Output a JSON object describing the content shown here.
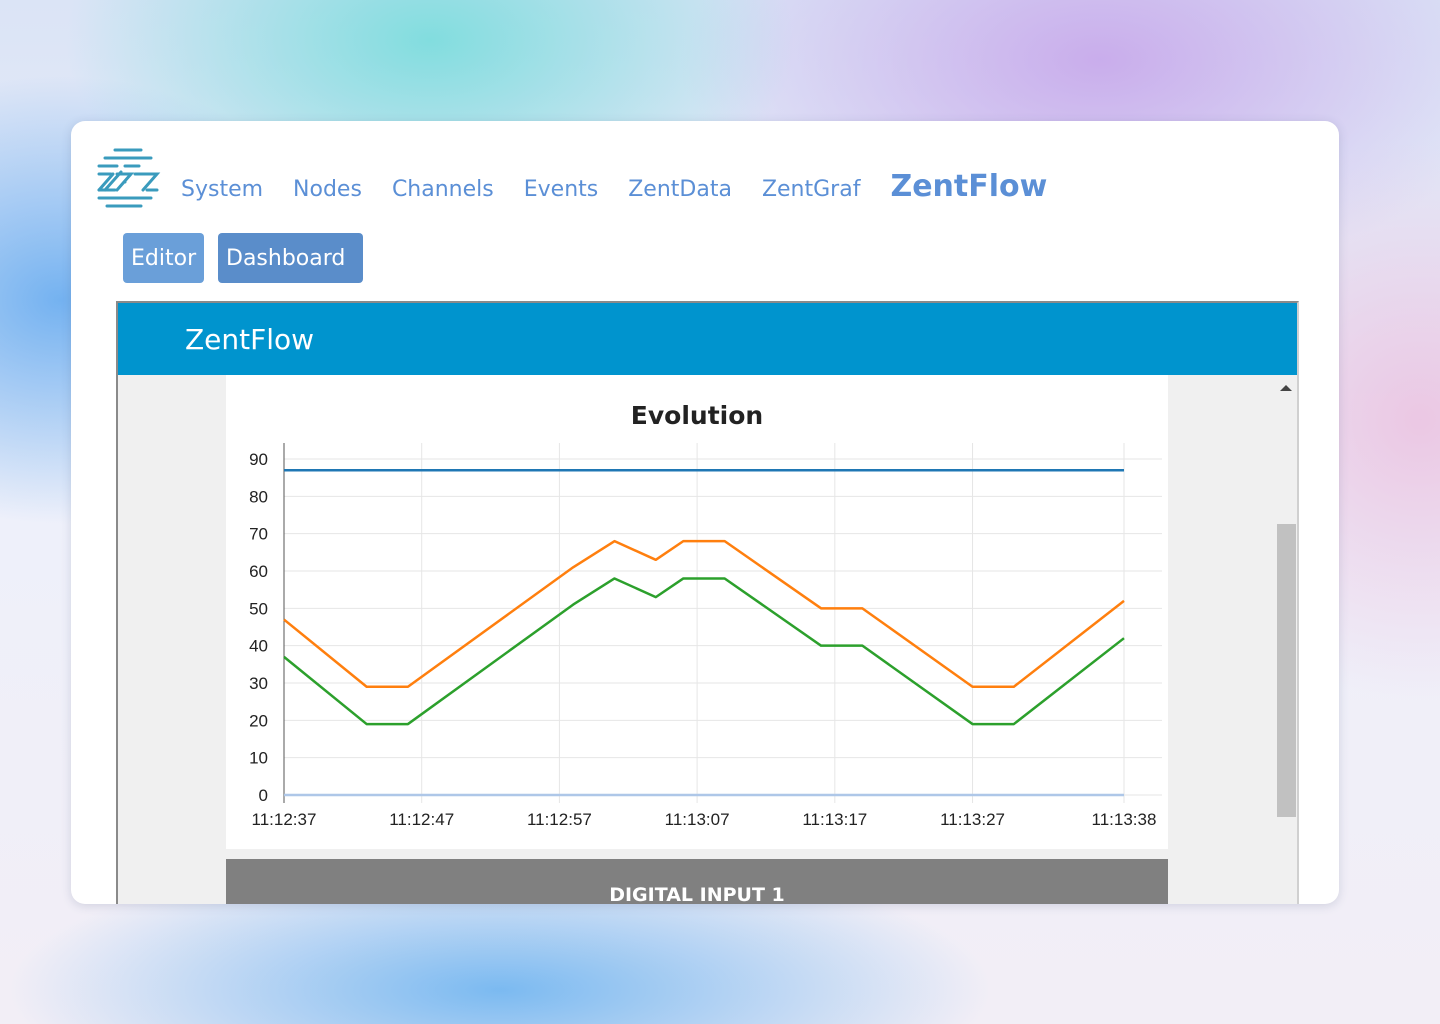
{
  "nav": {
    "items": [
      "System",
      "Nodes",
      "Channels",
      "Events",
      "ZentData",
      "ZentGraf"
    ],
    "active": "ZentFlow"
  },
  "subtabs": {
    "editor": "Editor",
    "dashboard": "Dashboard"
  },
  "dashboard": {
    "header_title": "ZentFlow",
    "next_section_label": "DIGITAL INPUT 1"
  },
  "colors": {
    "accent_nav": "#5b8fd6",
    "dashboard_header": "#0094ce",
    "series_blue": "#1f77b4",
    "series_orange": "#ff7f0e",
    "series_green": "#2ca02c",
    "series_lightblue": "#aec7e8"
  },
  "chart_data": {
    "type": "line",
    "title": "Evolution",
    "xlabel": "",
    "ylabel": "",
    "ylim": [
      0,
      90
    ],
    "yticks": [
      0,
      10,
      20,
      30,
      40,
      50,
      60,
      70,
      80,
      90
    ],
    "xlim_seconds_labels": [
      "11:12:37",
      "11:12:47",
      "11:12:57",
      "11:13:07",
      "11:13:17",
      "11:13:27",
      "11:13:38"
    ],
    "grid": true,
    "legend": "none",
    "series": [
      {
        "color": "#1f77b4",
        "x": [
          "11:12:37",
          "11:13:38"
        ],
        "y": [
          87,
          87
        ]
      },
      {
        "color": "#ff7f0e",
        "x": [
          "11:12:37",
          "11:12:43",
          "11:12:46",
          "11:12:58",
          "11:13:01",
          "11:13:04",
          "11:13:06",
          "11:13:09",
          "11:13:16",
          "11:13:19",
          "11:13:27",
          "11:13:30",
          "11:13:38"
        ],
        "y": [
          47,
          29,
          29,
          61,
          68,
          63,
          68,
          68,
          50,
          50,
          29,
          29,
          52
        ]
      },
      {
        "color": "#2ca02c",
        "x": [
          "11:12:37",
          "11:12:43",
          "11:12:46",
          "11:12:58",
          "11:13:01",
          "11:13:04",
          "11:13:06",
          "11:13:09",
          "11:13:16",
          "11:13:19",
          "11:13:27",
          "11:13:30",
          "11:13:38"
        ],
        "y": [
          37,
          19,
          19,
          51,
          58,
          53,
          58,
          58,
          40,
          40,
          19,
          19,
          42
        ]
      },
      {
        "color": "#aec7e8",
        "x": [
          "11:12:37",
          "11:13:38"
        ],
        "y": [
          0,
          0
        ]
      }
    ]
  }
}
